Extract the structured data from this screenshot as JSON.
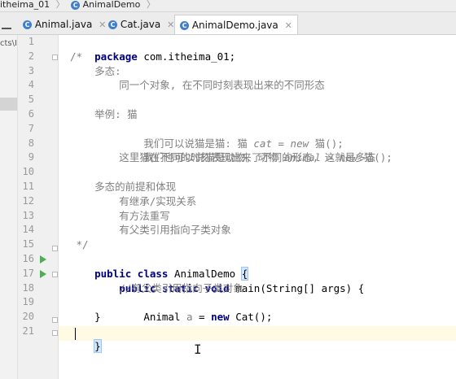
{
  "breadcrumb": {
    "project": "itheima_01",
    "file": "AnimalDemo"
  },
  "tabs": [
    {
      "label": "Animal.java",
      "active": false
    },
    {
      "label": "Cat.java",
      "active": false
    },
    {
      "label": "AnimalDemo.java",
      "active": true
    }
  ],
  "left_strip": {
    "path_fragment": "cts\\I"
  },
  "line_numbers": [
    "1",
    "2",
    "3",
    "4",
    "5",
    "6",
    "7",
    "8",
    "9",
    "10",
    "11",
    "12",
    "13",
    "14",
    "15",
    "16",
    "17",
    "18",
    "19",
    "20",
    "21"
  ],
  "code": {
    "l1_kw": "package",
    "l1_rest": " com.itheima_01;",
    "l2": "/*",
    "l3": "    多态:",
    "l4": "        同一个对象, 在不同时刻表现出来的不同形态",
    "l6": "    举例: 猫",
    "l7_a": "        我们可以说猫是猫: 猫 ",
    "l7_b": "cat = new ",
    "l7_c": "猫();",
    "l8_a": "        我们也可以说猫是动物, 动物 ",
    "l8_b": "animal = new ",
    "l8_c": "猫();",
    "l9": "        这里猫在不同的时刻表现出来了不同的形态, 这就是多态",
    "l11": "    多态的前提和体现",
    "l12": "        有继承/实现关系",
    "l13": "        有方法重写",
    "l14": "        有父类引用指向子类对象",
    "l15": " */",
    "l16_kw": "public class",
    "l16_name": " AnimalDemo ",
    "l16_brace": "{",
    "l17_indent": "    ",
    "l17_kw": "public static void",
    "l17_rest": " main(String[] args) {",
    "l18": "        //有父类引用指向子类对象",
    "l19_a": "        Animal ",
    "l19_var": "a",
    "l19_b": " = ",
    "l19_kw": "new",
    "l19_c": " Cat();",
    "l20": "    }",
    "l21": "}"
  },
  "colors": {
    "keyword": "#000080",
    "comment": "#808080",
    "run_icon": "#4caf50",
    "class_icon": "#3f7fcb"
  }
}
